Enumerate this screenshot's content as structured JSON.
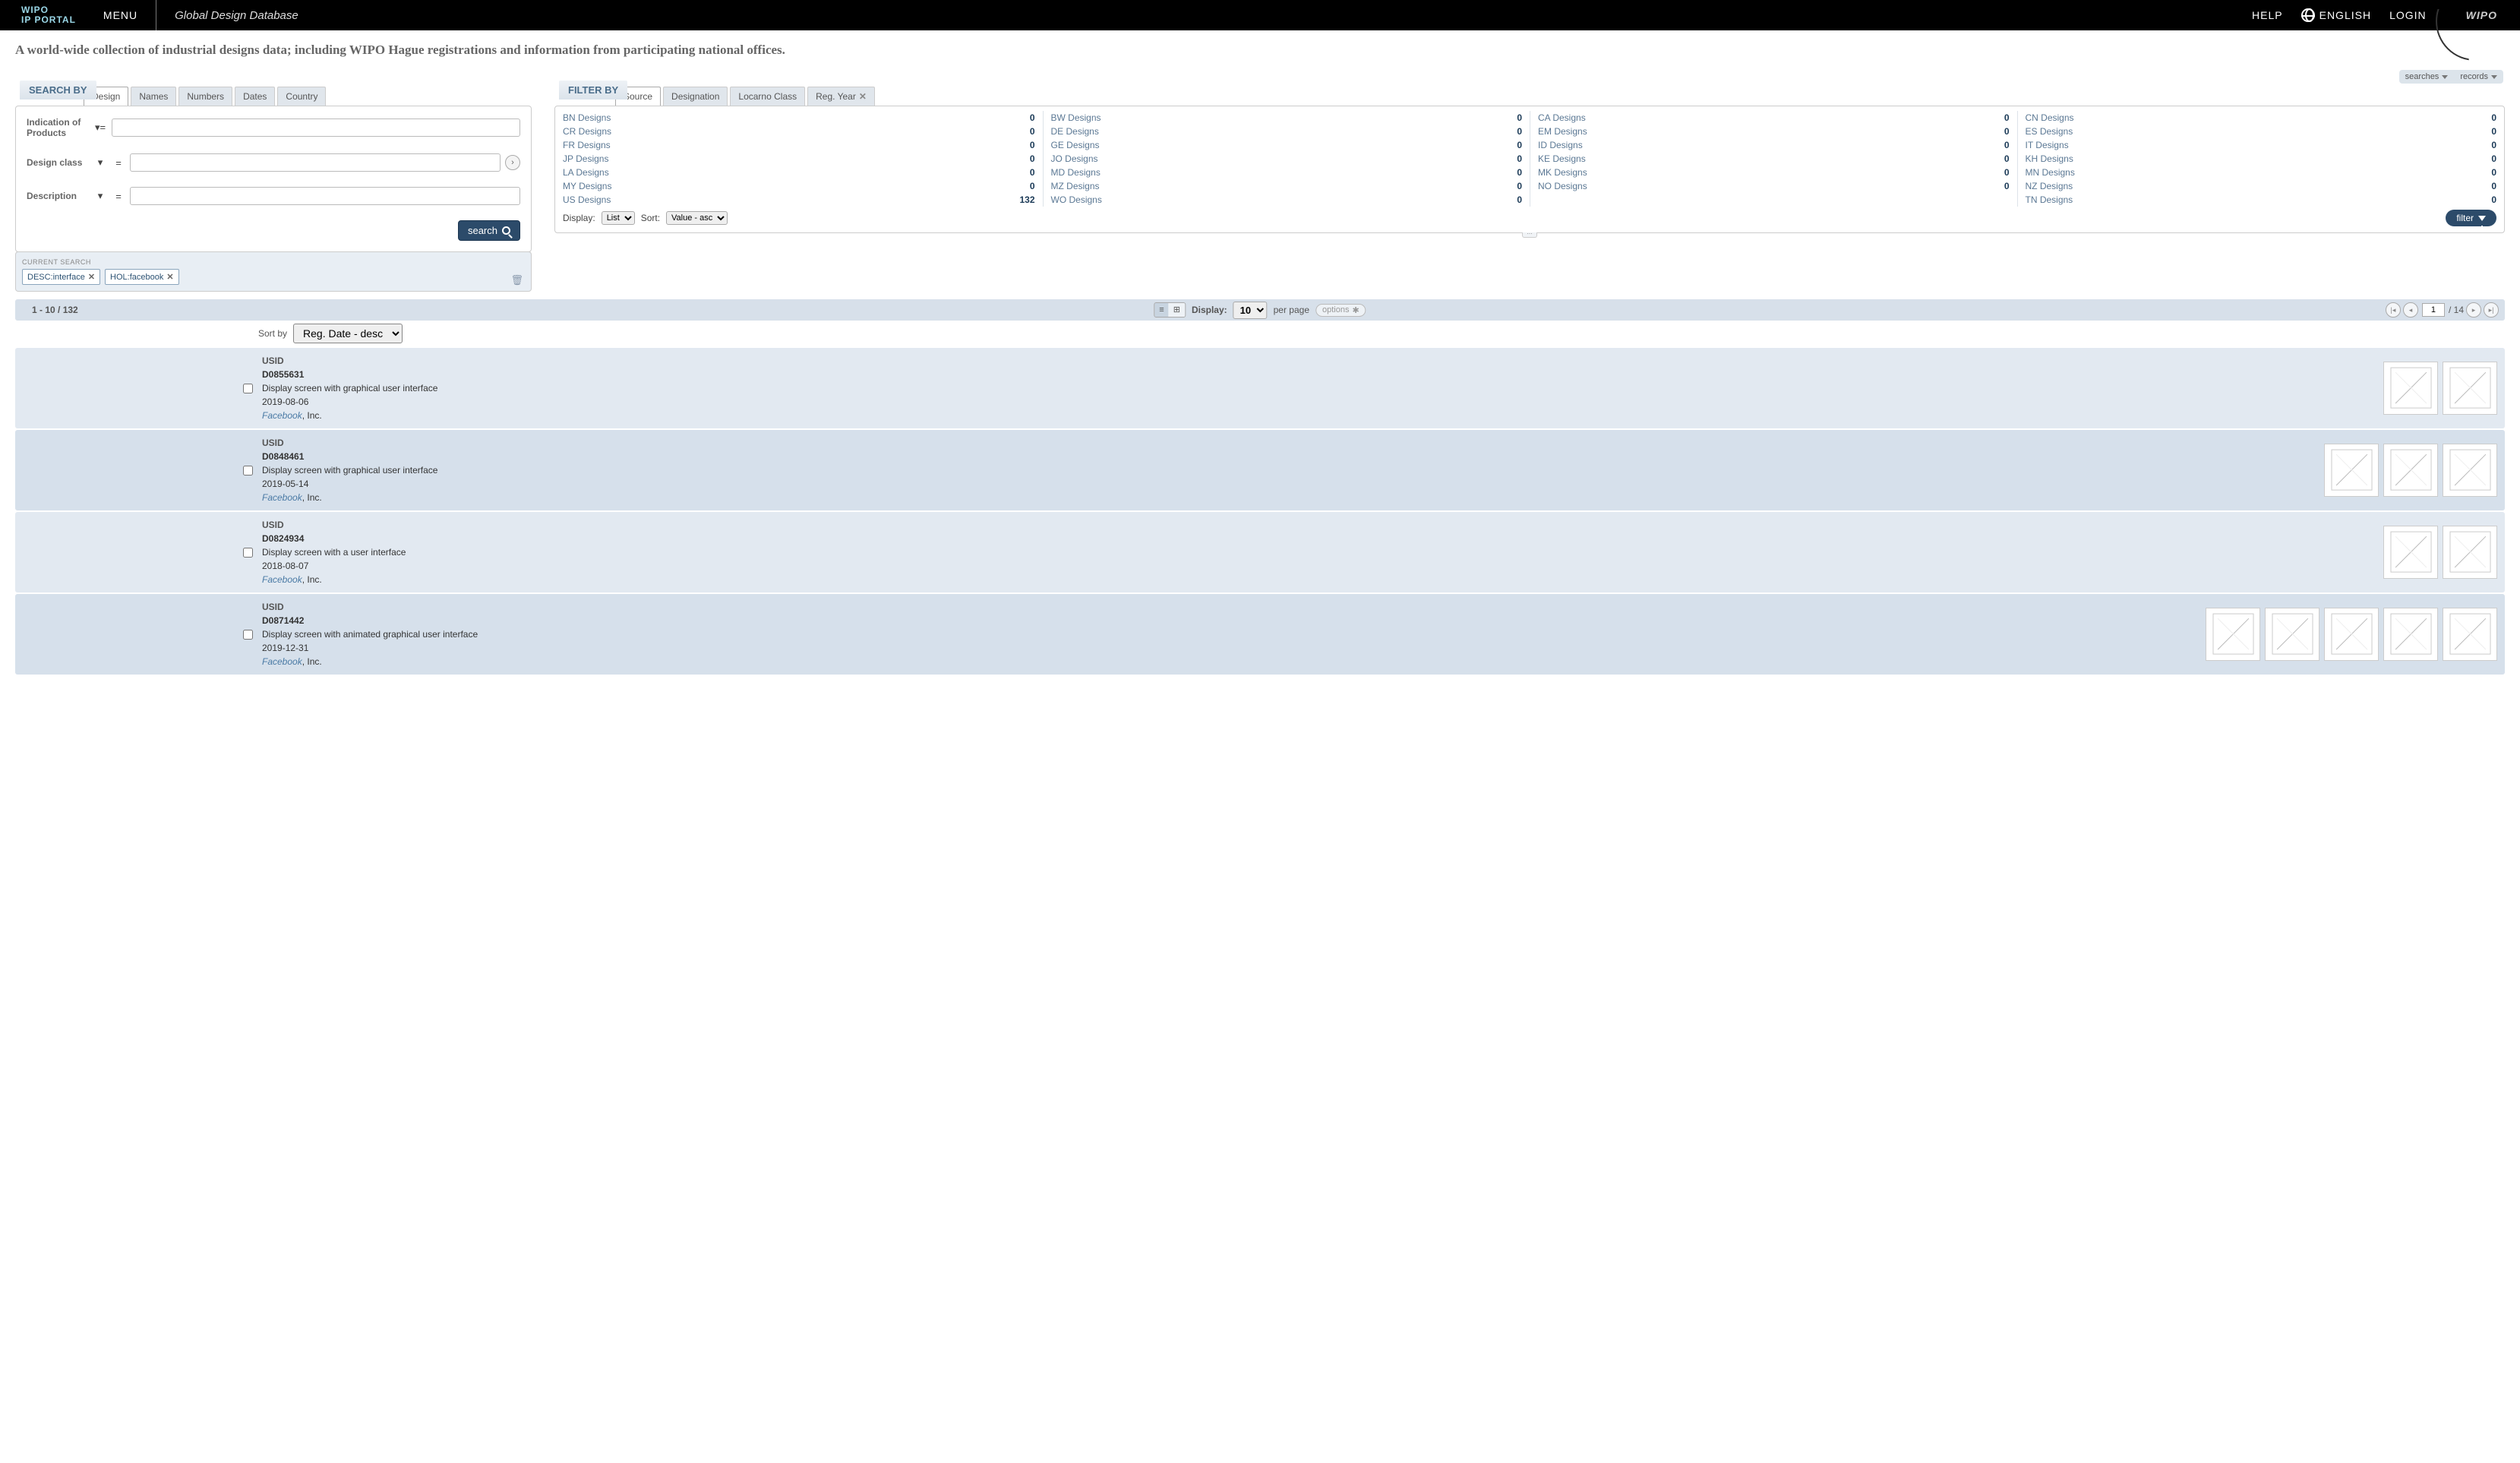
{
  "topbar": {
    "portal_line1": "WIPO",
    "portal_line2": "IP PORTAL",
    "menu": "MENU",
    "appname": "Global Design Database",
    "help": "HELP",
    "language": "ENGLISH",
    "login": "LOGIN",
    "logo": "WIPO"
  },
  "subtitle": "A world-wide collection of industrial designs data; including WIPO Hague registrations and information from participating national offices.",
  "utilbar": {
    "searches": "searches",
    "records": "records"
  },
  "search": {
    "label": "SEARCH BY",
    "tabs": [
      "Design",
      "Names",
      "Numbers",
      "Dates",
      "Country"
    ],
    "active_tab": 0,
    "fields": {
      "indication_label": "Indication of Products",
      "class_label": "Design class",
      "description_label": "Description"
    },
    "button": "search",
    "current_label": "CURRENT SEARCH",
    "chips": [
      "DESC:interface",
      "HOL:facebook"
    ]
  },
  "filter": {
    "label": "FILTER BY",
    "tabs": [
      "Source",
      "Designation",
      "Locarno Class",
      "Reg. Year"
    ],
    "active_tab": 0,
    "closable_tab": 3,
    "sources": [
      {
        "name": "BN Designs",
        "count": 0
      },
      {
        "name": "BW Designs",
        "count": 0
      },
      {
        "name": "CA Designs",
        "count": 0
      },
      {
        "name": "CN Designs",
        "count": 0
      },
      {
        "name": "CR Designs",
        "count": 0
      },
      {
        "name": "DE Designs",
        "count": 0
      },
      {
        "name": "EM Designs",
        "count": 0
      },
      {
        "name": "ES Designs",
        "count": 0
      },
      {
        "name": "FR Designs",
        "count": 0
      },
      {
        "name": "GE Designs",
        "count": 0
      },
      {
        "name": "ID Designs",
        "count": 0
      },
      {
        "name": "IT Designs",
        "count": 0
      },
      {
        "name": "JP Designs",
        "count": 0
      },
      {
        "name": "JO Designs",
        "count": 0
      },
      {
        "name": "KE Designs",
        "count": 0
      },
      {
        "name": "KH Designs",
        "count": 0
      },
      {
        "name": "LA Designs",
        "count": 0
      },
      {
        "name": "MD Designs",
        "count": 0
      },
      {
        "name": "MK Designs",
        "count": 0
      },
      {
        "name": "MN Designs",
        "count": 0
      },
      {
        "name": "MY Designs",
        "count": 0
      },
      {
        "name": "MZ Designs",
        "count": 0
      },
      {
        "name": "NO Designs",
        "count": 0
      },
      {
        "name": "NZ Designs",
        "count": 0
      },
      {
        "name": "TN Designs",
        "count": 0
      },
      {
        "name": "US Designs",
        "count": 132
      },
      {
        "name": "WO Designs",
        "count": 0
      }
    ],
    "display_label": "Display:",
    "display_value": "List",
    "sort_label": "Sort:",
    "sort_value": "Value - asc",
    "button": "filter"
  },
  "resultsbar": {
    "range": "1 - 10 / 132",
    "display_label": "Display:",
    "per_page": "10",
    "per_page_label": "per page",
    "options": "options",
    "page_input": "1",
    "page_sep": "/ 14"
  },
  "sort": {
    "label": "Sort by",
    "value": "Reg. Date - desc"
  },
  "results": [
    {
      "src": "USID",
      "num": "D0855631",
      "title": "Display screen with graphical user interface",
      "date": "2019-08-06",
      "holder_hl": "Facebook",
      "holder_rest": ", Inc.",
      "thumbs": 2
    },
    {
      "src": "USID",
      "num": "D0848461",
      "title": "Display screen with graphical user interface",
      "date": "2019-05-14",
      "holder_hl": "Facebook",
      "holder_rest": ", Inc.",
      "thumbs": 3
    },
    {
      "src": "USID",
      "num": "D0824934",
      "title": "Display screen with a user interface",
      "date": "2018-08-07",
      "holder_hl": "Facebook",
      "holder_rest": ", Inc.",
      "thumbs": 2
    },
    {
      "src": "USID",
      "num": "D0871442",
      "title": "Display screen with animated graphical user interface",
      "date": "2019-12-31",
      "holder_hl": "Facebook",
      "holder_rest": ", Inc.",
      "thumbs": 5
    }
  ]
}
